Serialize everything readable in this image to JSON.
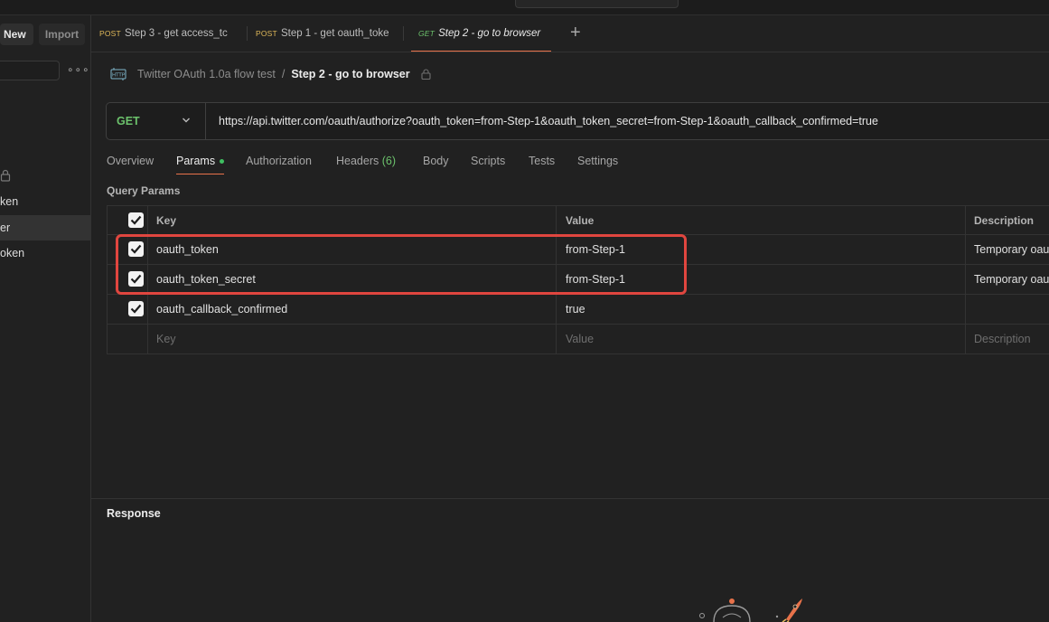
{
  "sidebar": {
    "new_label": "New",
    "import_label": "Import",
    "items": [
      {
        "label": "ken",
        "active": false
      },
      {
        "label": "er",
        "active": true
      },
      {
        "label": "oken",
        "active": false
      }
    ]
  },
  "tabs": [
    {
      "method": "POST",
      "label": "Step 3 - get access_tc",
      "unsaved": true
    },
    {
      "method": "POST",
      "label": "Step 1 - get oauth_toke",
      "unsaved": false
    },
    {
      "method": "GET",
      "label": "Step 2 - go to browser",
      "active": true
    }
  ],
  "breadcrumb": {
    "collection": "Twitter OAuth 1.0a flow test",
    "separator": "/",
    "request": "Step 2 - go to browser"
  },
  "request": {
    "method": "GET",
    "url": "https://api.twitter.com/oauth/authorize?oauth_token=from-Step-1&oauth_token_secret=from-Step-1&oauth_callback_confirmed=true"
  },
  "subtabs": {
    "overview": "Overview",
    "params": "Params",
    "authorization": "Authorization",
    "headers": "Headers",
    "headers_count": "(6)",
    "body": "Body",
    "scripts": "Scripts",
    "tests": "Tests",
    "settings": "Settings"
  },
  "query_params": {
    "title": "Query Params",
    "headers": {
      "key": "Key",
      "value": "Value",
      "description": "Description"
    },
    "rows": [
      {
        "key": "oauth_token",
        "value": "from-Step-1",
        "description": "Temporary oau",
        "checked": true
      },
      {
        "key": "oauth_token_secret",
        "value": "from-Step-1",
        "description": "Temporary oau",
        "checked": true
      },
      {
        "key": "oauth_callback_confirmed",
        "value": "true",
        "description": "",
        "checked": true
      }
    ],
    "placeholders": {
      "key": "Key",
      "value": "Value",
      "description": "Description"
    }
  },
  "response": {
    "title": "Response"
  },
  "colors": {
    "accent": "#e8724a",
    "get": "#6cc26c",
    "post": "#e0b95a",
    "highlight": "#e0463f"
  }
}
